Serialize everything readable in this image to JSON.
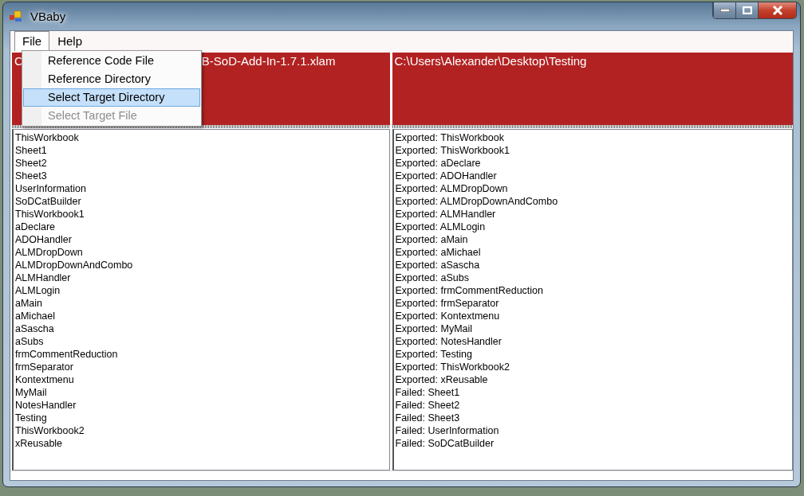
{
  "window": {
    "title": "VBaby"
  },
  "menu": [
    {
      "label": "File",
      "selected": true
    },
    {
      "label": "Help",
      "selected": false
    }
  ],
  "dropdown": [
    {
      "label": "Reference Code File",
      "selected": false,
      "disabled": false
    },
    {
      "label": "Reference Directory",
      "selected": false,
      "disabled": false
    },
    {
      "label": "Select Target Directory",
      "selected": true,
      "disabled": false
    },
    {
      "label": "Select Target File",
      "selected": false,
      "disabled": true
    }
  ],
  "left_panel": {
    "header": [
      "C",
      "B-SoD-Add-In-1.7.1.xlam"
    ],
    "items": [
      "ThisWorkbook",
      "Sheet1",
      "Sheet2",
      "Sheet3",
      "UserInformation",
      "SoDCatBuilder",
      "ThisWorkbook1",
      "aDeclare",
      "ADOHandler",
      "ALMDropDown",
      "ALMDropDownAndCombo",
      "ALMHandler",
      "ALMLogin",
      "aMain",
      "aMichael",
      "aSascha",
      "aSubs",
      "frmCommentReduction",
      "frmSeparator",
      "Kontextmenu",
      "MyMail",
      "NotesHandler",
      "Testing",
      "ThisWorkbook2",
      "xReusable"
    ]
  },
  "right_panel": {
    "header": [
      "C:\\Users\\Alexander\\Desktop\\Testing"
    ],
    "items": [
      "Exported: ThisWorkbook",
      "Exported: ThisWorkbook1",
      "Exported: aDeclare",
      "Exported: ADOHandler",
      "Exported: ALMDropDown",
      "Exported: ALMDropDownAndCombo",
      "Exported: ALMHandler",
      "Exported: ALMLogin",
      "Exported: aMain",
      "Exported: aMichael",
      "Exported: aSascha",
      "Exported: aSubs",
      "Exported: frmCommentReduction",
      "Exported: frmSeparator",
      "Exported: Kontextmenu",
      "Exported: MyMail",
      "Exported: NotesHandler",
      "Exported: Testing",
      "Exported: ThisWorkbook2",
      "Exported: xReusable",
      "Failed: Sheet1",
      "Failed: Sheet2",
      "Failed: Sheet3",
      "Failed: UserInformation",
      "Failed: SoDCatBuilder"
    ]
  }
}
